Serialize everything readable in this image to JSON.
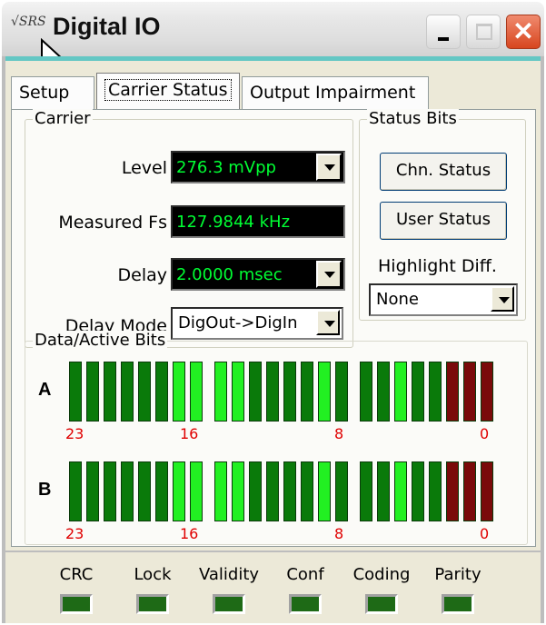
{
  "window": {
    "title": "Digital IO",
    "icon_text": "√SRS",
    "close_glyph": "✕"
  },
  "tabs": [
    {
      "label": "Setup"
    },
    {
      "label": "Carrier Status"
    },
    {
      "label": "Output Impairment"
    }
  ],
  "carrier": {
    "group_label": "Carrier",
    "level_label": "Level",
    "level_value": "276.3 mVpp",
    "fs_label": "Measured Fs",
    "fs_value": "127.9844 kHz",
    "delay_label": "Delay",
    "delay_value": "2.0000 msec",
    "delay_mode_label": "Delay Mode",
    "delay_mode_value": "DigOut->DigIn"
  },
  "status_bits": {
    "group_label": "Status Bits",
    "chn_status_label": "Chn. Status",
    "user_status_label": "User Status",
    "highlight_label": "Highlight Diff.",
    "highlight_value": "None"
  },
  "data_bits": {
    "group_label": "Data/Active Bits",
    "colors": {
      "dark": "#0a7a0a",
      "light": "#22f022",
      "red": "#7a0a0a"
    },
    "rows": [
      {
        "label": "A",
        "bits": [
          "dark",
          "dark",
          "dark",
          "dark",
          "dark",
          "dark",
          "light",
          "light",
          "light",
          "light",
          "dark",
          "dark",
          "dark",
          "dark",
          "light",
          "dark",
          "dark",
          "dark",
          "light",
          "dark",
          "dark",
          "red",
          "red",
          "red"
        ]
      },
      {
        "label": "B",
        "bits": [
          "dark",
          "dark",
          "dark",
          "dark",
          "dark",
          "dark",
          "light",
          "light",
          "light",
          "light",
          "dark",
          "dark",
          "dark",
          "dark",
          "light",
          "dark",
          "dark",
          "dark",
          "light",
          "dark",
          "dark",
          "red",
          "red",
          "red"
        ]
      }
    ],
    "bit_numbers": [
      "23",
      "16",
      "8",
      "0"
    ]
  },
  "indicators": [
    {
      "label": "CRC"
    },
    {
      "label": "Lock"
    },
    {
      "label": "Validity"
    },
    {
      "label": "Conf"
    },
    {
      "label": "Coding"
    },
    {
      "label": "Parity"
    }
  ]
}
